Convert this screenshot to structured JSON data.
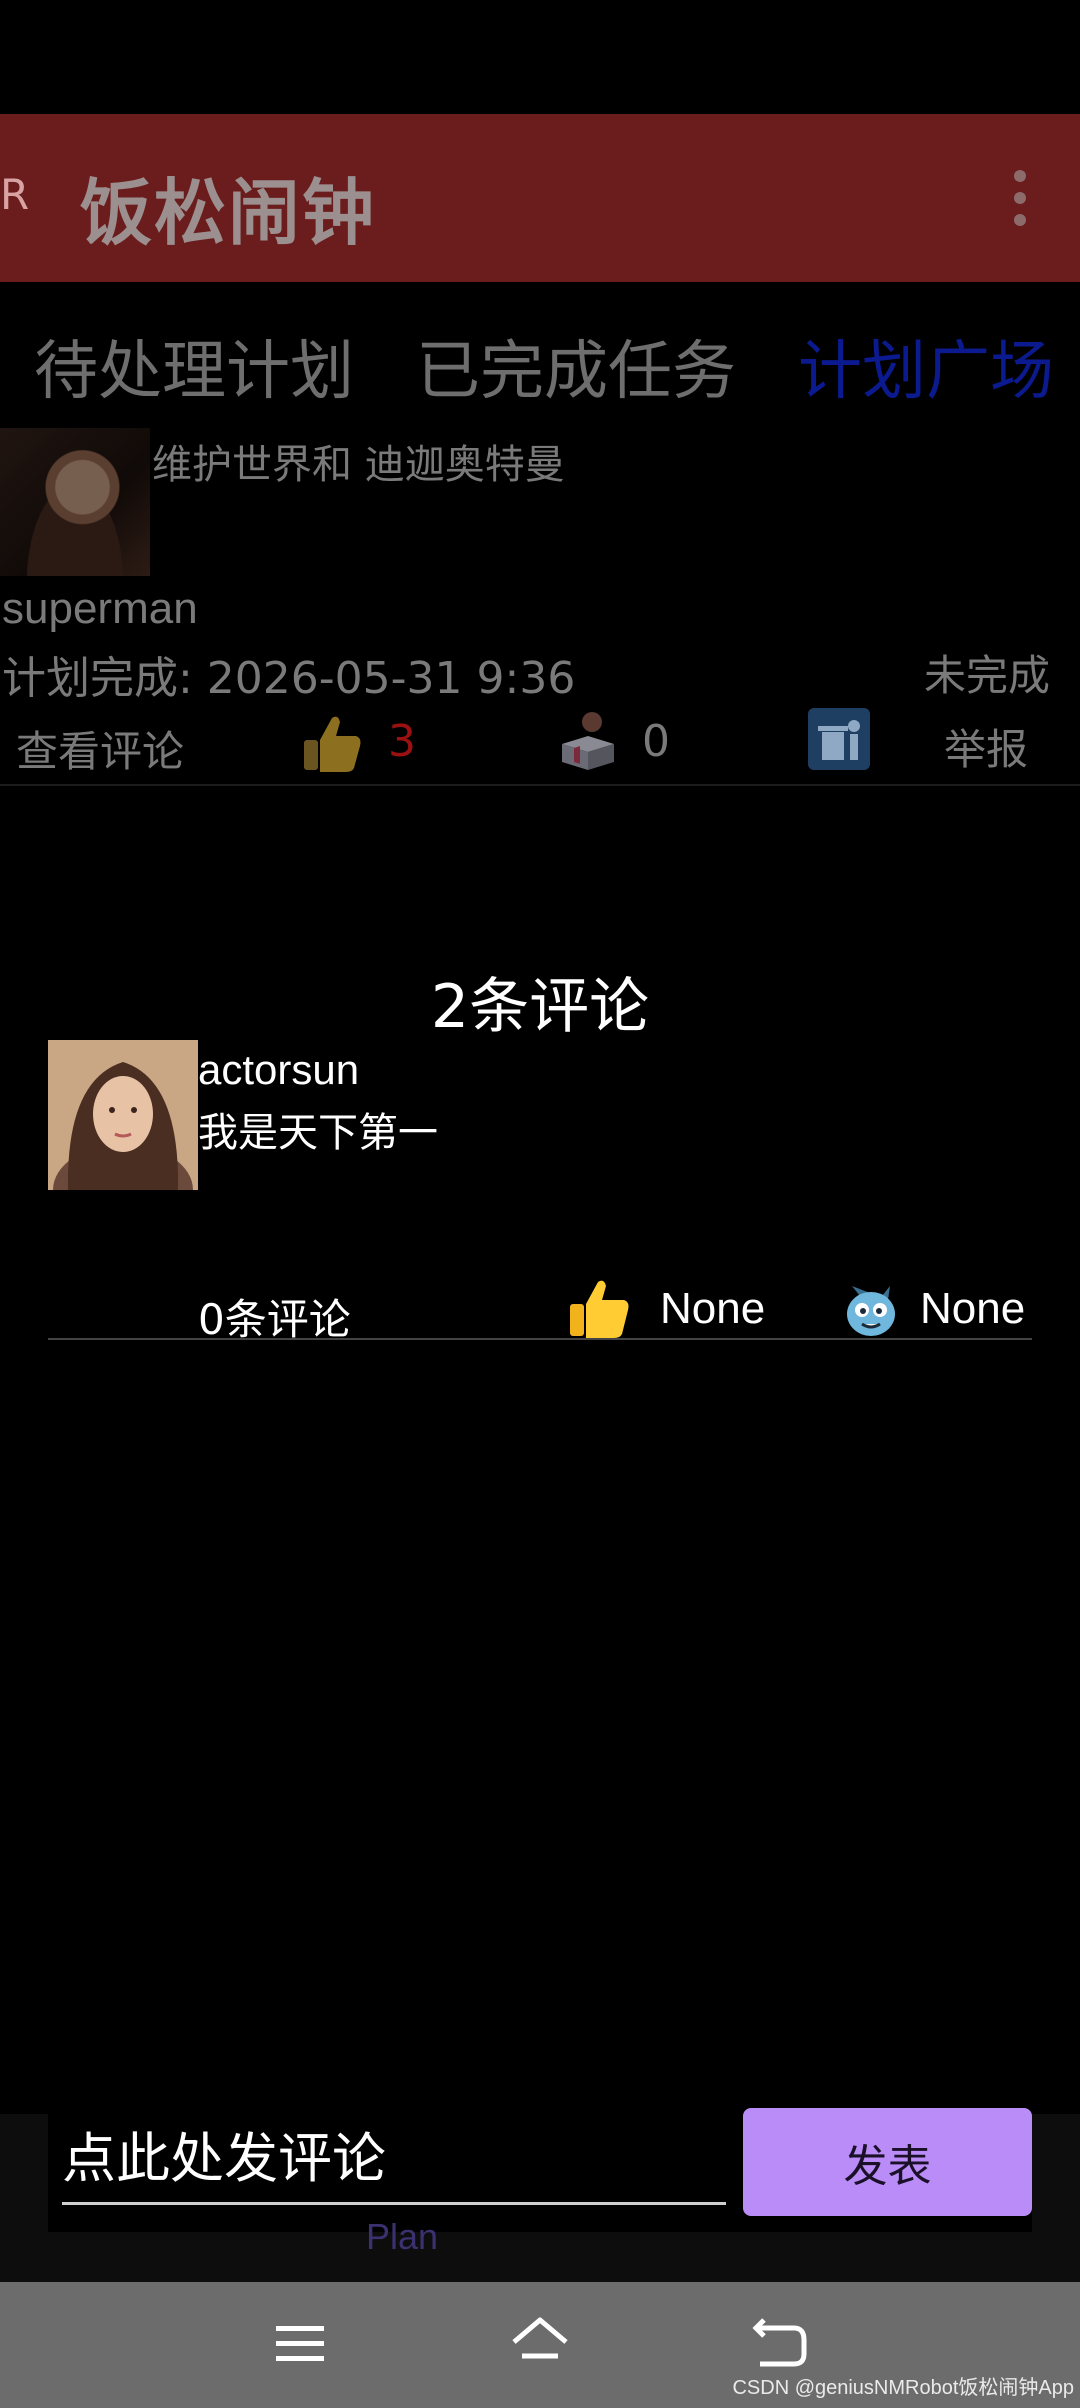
{
  "app_bar": {
    "nav_letter": "R",
    "title": "饭松闹钟"
  },
  "tabs": [
    {
      "label": "待处理计划",
      "active": false
    },
    {
      "label": "已完成任务",
      "active": false
    },
    {
      "label": "计划广场",
      "active": true
    }
  ],
  "plan_card": {
    "title": "维护世界和 迪迦奥特曼",
    "username": "superman",
    "deadline_label": "计划完成: 2026-05-31 9:36",
    "status": "未完成",
    "view_comments_label": "查看评论",
    "likes": "3",
    "gifts": "0",
    "report_label": "举报"
  },
  "comments_dialog": {
    "count_label": "2条评论",
    "comments": [
      {
        "username": "actorsun",
        "text": "我是天下第一",
        "reply_count_label": "0条评论",
        "likes": "None",
        "reactions": "None"
      }
    ]
  },
  "composer": {
    "placeholder": "点此处发评论",
    "submit_label": "发表"
  },
  "background_nav_label": "Plan",
  "watermark": "CSDN @geniusNMRobot饭松闹钟App",
  "colors": {
    "app_bar": "#6b1d1d",
    "active_tab": "#0b1a8e",
    "like_count": "#9b1111",
    "submit_button": "#b98cf7",
    "system_nav": "#6c6c6c"
  }
}
